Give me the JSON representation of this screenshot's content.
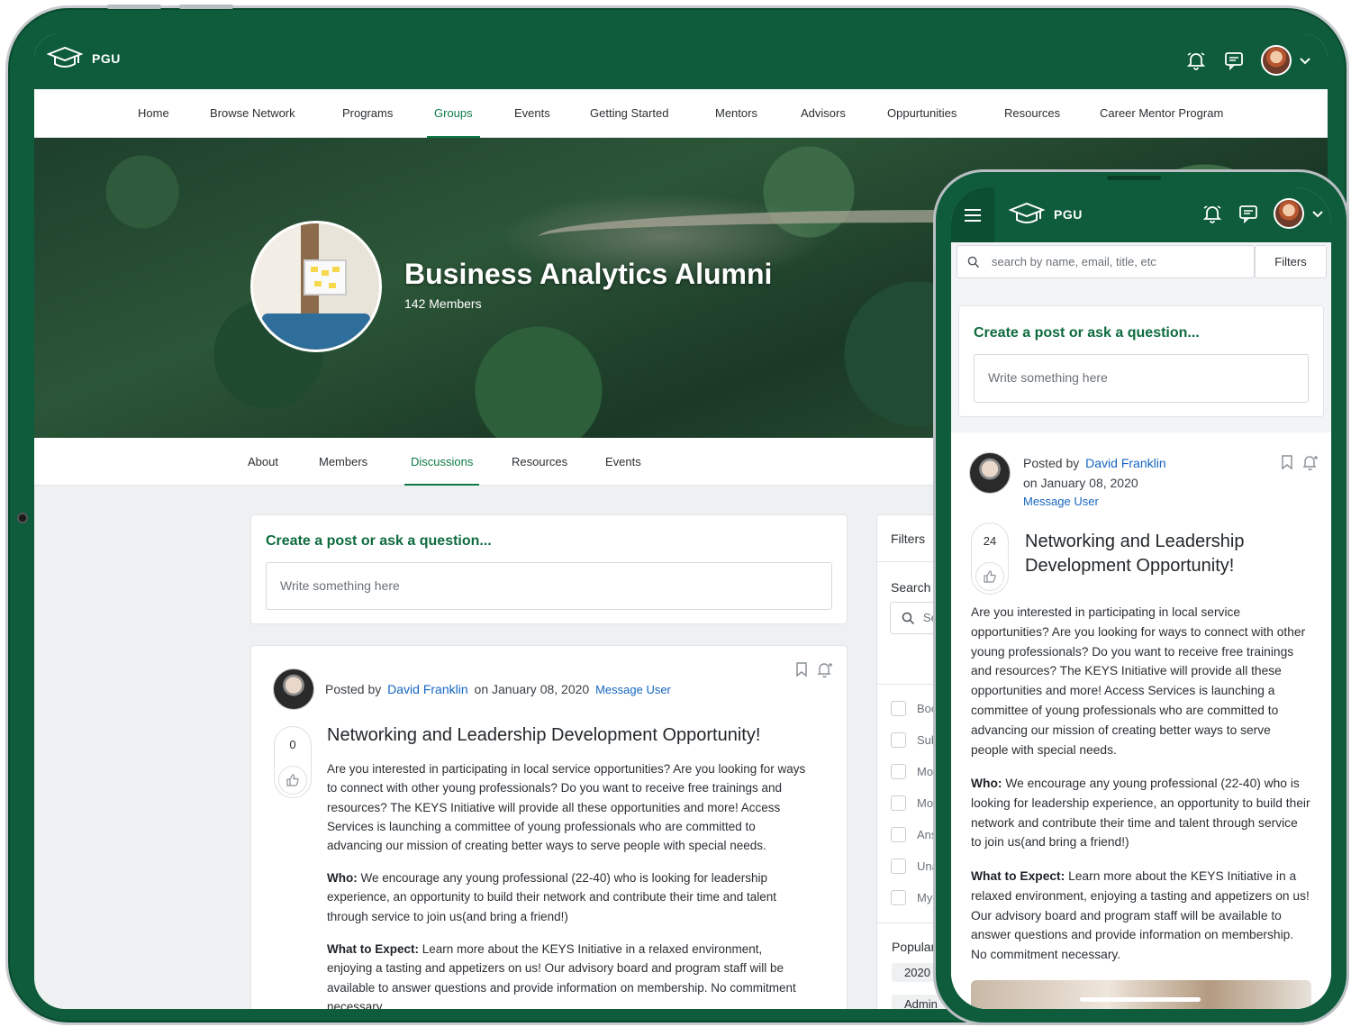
{
  "app": {
    "brand": "PGU"
  },
  "nav": [
    {
      "label": "Home",
      "active": false
    },
    {
      "label": "Browse Network",
      "active": false
    },
    {
      "label": "Programs",
      "active": false
    },
    {
      "label": "Groups",
      "active": true
    },
    {
      "label": "Events",
      "active": false
    },
    {
      "label": "Getting Started",
      "active": false
    },
    {
      "label": "Mentors",
      "active": false
    },
    {
      "label": "Advisors",
      "active": false
    },
    {
      "label": "Oppurtunities",
      "active": false
    },
    {
      "label": "Resources",
      "active": false
    },
    {
      "label": "Career Mentor Program",
      "active": false
    }
  ],
  "group": {
    "title": "Business Analytics Alumni",
    "members": "142 Members"
  },
  "subnav": [
    {
      "label": "About",
      "active": false
    },
    {
      "label": "Members",
      "active": false
    },
    {
      "label": "Discussions",
      "active": true
    },
    {
      "label": "Resources",
      "active": false
    },
    {
      "label": "Events",
      "active": false
    }
  ],
  "compose": {
    "title": "Create a post or ask a question...",
    "placeholder": "Write something here"
  },
  "post": {
    "posted_by": "Posted by",
    "author": "David Franklin",
    "date": "on January 08, 2020",
    "message": "Message User",
    "votes_desktop": "0",
    "votes_mobile": "24",
    "title": "Networking and Leadership Development Opportunity!",
    "para1": "Are you interested in participating in local service opportunities? Are you looking for ways to connect with other young professionals? Do you want to receive free trainings and resources? The KEYS Initiative will provide all these opportunities and more! Access Services is launching a committee of young professionals who are committed to advancing our mission of creating better ways to serve people with special needs.",
    "who_label": "Who:",
    "who_text": " We encourage any young professional (22-40) who is looking for leadership experience, an opportunity to build their network and contribute their time and talent through service to join us(and bring a friend!)",
    "expect_label": "What to Expect:",
    "expect_text": " Learn more about the KEYS Initiative in a relaxed environment, enjoying a tasting and appetizers on us! Our advisory board and program staff will be available to answer questions and provide information on membership. No commitment necessary."
  },
  "filters": {
    "title": "Filters",
    "search_label": "Search D",
    "search_placeholder": "Sea",
    "options": [
      "Boo",
      "Sub",
      "Mos",
      "Mos",
      "Ans",
      "Una",
      "My"
    ],
    "popular_label": "Popular",
    "tags": [
      "2020",
      "Admin"
    ]
  },
  "mobile": {
    "search_placeholder": "search by name, email, title, etc",
    "filters_button": "Filters"
  },
  "colors": {
    "brand_green": "#0e5c3b",
    "accent_green": "#0e7a45",
    "link_blue": "#1565c0"
  }
}
